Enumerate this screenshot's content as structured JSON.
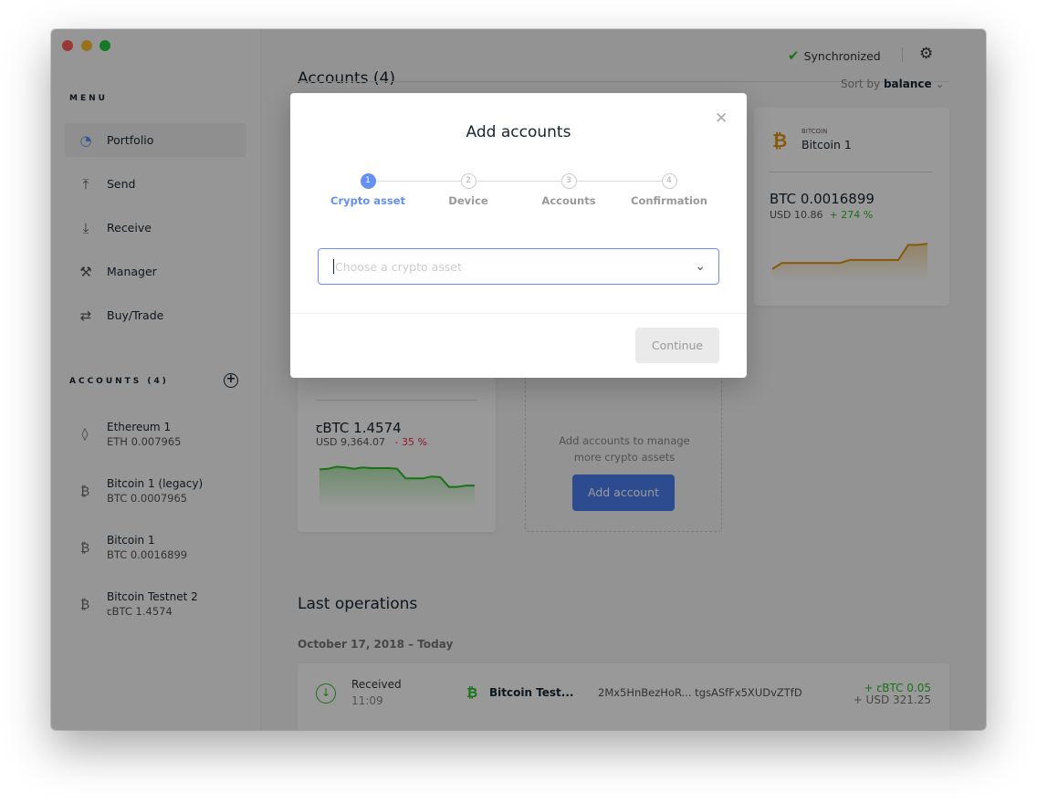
{
  "window": {
    "traffic_lights": [
      "#fc5f57",
      "#fdbc2e",
      "#28c840"
    ]
  },
  "sidebar": {
    "menu_title": "MENU",
    "items": [
      {
        "label": "Portfolio",
        "icon": "pie-chart-icon"
      },
      {
        "label": "Send",
        "icon": "arrow-up-icon"
      },
      {
        "label": "Receive",
        "icon": "arrow-down-icon"
      },
      {
        "label": "Manager",
        "icon": "tools-icon"
      },
      {
        "label": "Buy/Trade",
        "icon": "swap-icon"
      }
    ],
    "accounts_title": "ACCOUNTS (4)",
    "accounts": [
      {
        "name": "Ethereum 1",
        "balance": "ETH 0.007965",
        "icon": "ethereum-icon"
      },
      {
        "name": "Bitcoin 1 (legacy)",
        "balance": "BTC 0.0007965",
        "icon": "bitcoin-icon"
      },
      {
        "name": "Bitcoin 1",
        "balance": "BTC 0.0016899",
        "icon": "bitcoin-icon"
      },
      {
        "name": "Bitcoin Testnet 2",
        "balance": "ꞇBTC 1.4574",
        "icon": "bitcoin-icon"
      }
    ]
  },
  "topbar": {
    "sync_label": "Synchronized"
  },
  "main": {
    "accounts_title": "Accounts (4)",
    "sort_label": "Sort by",
    "sort_value": "balance",
    "card_btc1": {
      "currency": "BITCOIN",
      "name": "Bitcoin 1",
      "balance": "BTC 0.0016899",
      "fiat": "USD 10.86",
      "change": "+ 274 %",
      "color": "#e3940b",
      "spark": [
        2,
        3,
        3,
        3,
        3,
        3,
        3,
        3,
        3.5,
        3.5,
        3.5,
        3.5,
        3.5,
        3.5,
        6,
        6,
        6.2
      ]
    },
    "card_tbtc": {
      "balance": "ꞇBTC 1.4574",
      "fiat": "USD 9,364.07",
      "change": "- 35 %",
      "color": "#2bbf25",
      "spark": [
        6,
        6.1,
        6.4,
        6.3,
        6.1,
        6.3,
        6.2,
        6.2,
        6.2,
        6.1,
        4.6,
        4.6,
        4.6,
        4.9,
        4.8,
        3.3,
        3.3,
        3.5,
        3.5
      ]
    },
    "add_card": {
      "text": "Add accounts to manage more crypto assets",
      "button": "Add account"
    },
    "last_ops_title": "Last operations",
    "date_label": "October 17, 2018 – Today",
    "operations": [
      {
        "type": "Received",
        "time": "11:09",
        "account": "Bitcoin Test...",
        "address": "2Mx5HnBezHoR... tgsASfFx5XUDvZTfD",
        "amount": "+ ꞇBTC 0.05",
        "fiat": "+ USD 321.25"
      }
    ]
  },
  "modal": {
    "title": "Add accounts",
    "steps": [
      {
        "n": "1",
        "label": "Crypto asset"
      },
      {
        "n": "2",
        "label": "Device"
      },
      {
        "n": "3",
        "label": "Accounts"
      },
      {
        "n": "4",
        "label": "Confirmation"
      }
    ],
    "select_placeholder": "Choose a crypto asset",
    "continue": "Continue"
  }
}
